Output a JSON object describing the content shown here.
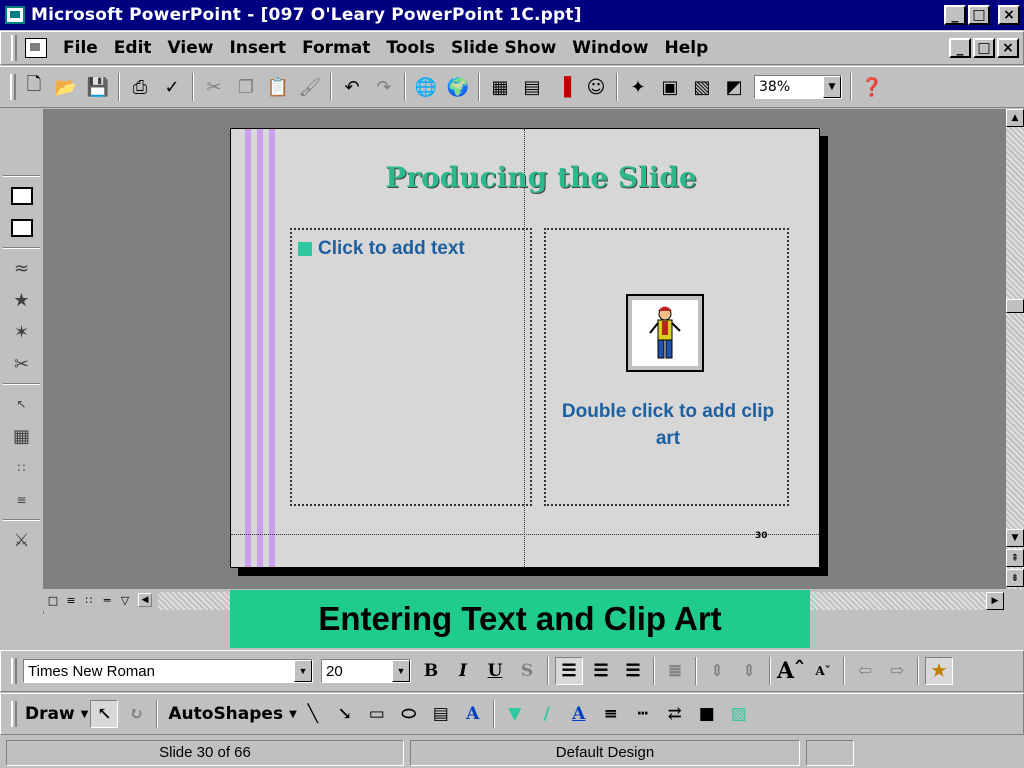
{
  "window": {
    "title": "Microsoft PowerPoint - [097 O'Leary PowerPoint 1C.ppt]",
    "min_label": "_",
    "restore_label": "□",
    "close_label": "×"
  },
  "menu": {
    "items": [
      "File",
      "Edit",
      "View",
      "Insert",
      "Format",
      "Tools",
      "Slide Show",
      "Window",
      "Help"
    ]
  },
  "standard_toolbar": {
    "zoom": "38%",
    "icons": [
      "new-icon",
      "open-icon",
      "save-icon",
      "print-icon",
      "spelling-icon",
      "cut-icon",
      "copy-icon",
      "paste-icon",
      "format-painter-icon",
      "undo-icon",
      "redo-icon",
      "insert-hyperlink-icon",
      "web-toolbar-icon",
      "insert-word-table-icon",
      "insert-excel-icon",
      "insert-chart-icon",
      "insert-clipart-icon",
      "new-slide-icon",
      "slide-layout-icon",
      "apply-design-icon",
      "black-white-view-icon",
      "help-icon"
    ]
  },
  "slide": {
    "title": "Producing the Slide",
    "bullet_text": "Click to add text",
    "clipart_caption": "Double click to add clip art",
    "number": "30",
    "stripe_color": "#c8a0ec",
    "title_color": "#2eb88e",
    "text_color": "#1e5fa0"
  },
  "caption_banner": {
    "text": "Entering Text and Clip Art",
    "color": "#1fcc8e"
  },
  "formatting_toolbar": {
    "font": "Times New Roman",
    "size": "20",
    "bold": "B",
    "italic": "I",
    "underline": "U",
    "shadow": "S"
  },
  "drawing_toolbar": {
    "draw_label": "Draw",
    "autoshapes_label": "AutoShapes"
  },
  "status": {
    "slide_position": "Slide 30 of 66",
    "design": "Default Design"
  }
}
